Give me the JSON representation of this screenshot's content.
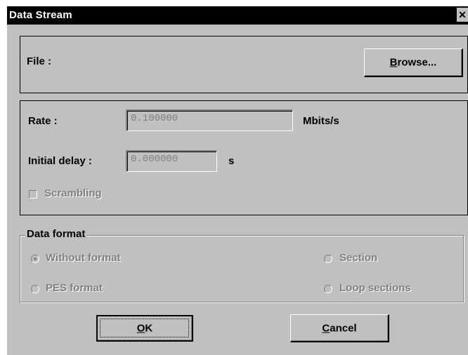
{
  "window": {
    "title": "Data Stream",
    "close_glyph": "✕"
  },
  "file": {
    "label": "File :",
    "browse_label": "Browse...",
    "browse_accel": "B",
    "browse_rest": "rowse..."
  },
  "rate": {
    "label": "Rate :",
    "value": "0.100000",
    "unit": "Mbits/s"
  },
  "delay": {
    "label": "Initial delay :",
    "value": "0.000000",
    "unit": "s"
  },
  "scrambling": {
    "label": "Scrambling",
    "checked": false
  },
  "data_format": {
    "legend": "Data format",
    "options": [
      {
        "label": "Without format",
        "checked": true
      },
      {
        "label": "Section",
        "checked": false
      },
      {
        "label": "PES format",
        "checked": false
      },
      {
        "label": "Loop sections",
        "checked": false
      }
    ]
  },
  "buttons": {
    "ok_accel": "O",
    "ok_rest": "K",
    "cancel_accel": "C",
    "cancel_rest": "ancel"
  }
}
